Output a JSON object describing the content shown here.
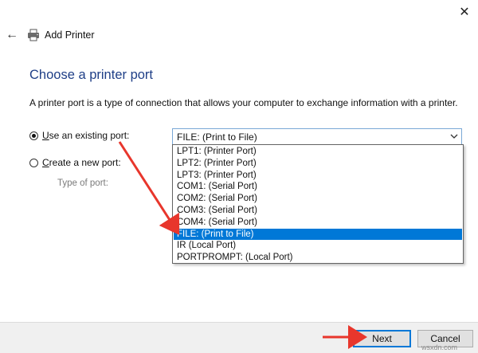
{
  "window": {
    "title": "Add Printer",
    "close_glyph": "✕",
    "back_glyph": "←"
  },
  "heading": "Choose a printer port",
  "description": "A printer port is a type of connection that allows your computer to exchange information with a printer.",
  "options": {
    "existing": {
      "prefix": "",
      "underlined": "U",
      "rest": "se an existing port:",
      "selected": true
    },
    "new": {
      "prefix": "",
      "underlined": "C",
      "rest": "reate a new port:",
      "selected": false
    }
  },
  "type_of_port_label": "Type of port:",
  "port_select": {
    "value": "FILE: (Print to File)",
    "chevron": "⌄"
  },
  "port_list": {
    "items": [
      "LPT1: (Printer Port)",
      "LPT2: (Printer Port)",
      "LPT3: (Printer Port)",
      "COM1: (Serial Port)",
      "COM2: (Serial Port)",
      "COM3: (Serial Port)",
      "COM4: (Serial Port)",
      "FILE: (Print to File)",
      "IR (Local Port)",
      "PORTPROMPT: (Local Port)"
    ],
    "selected_index": 7
  },
  "buttons": {
    "next": "Next",
    "cancel": "Cancel"
  },
  "watermark": "wsxdn.com",
  "colors": {
    "heading": "#1f3f87",
    "selection": "#0078d7",
    "arrow": "#e8362c"
  },
  "icons": {
    "back": "back-arrow-icon",
    "printer": "printer-icon",
    "close": "close-icon",
    "chevron": "chevron-down-icon"
  }
}
